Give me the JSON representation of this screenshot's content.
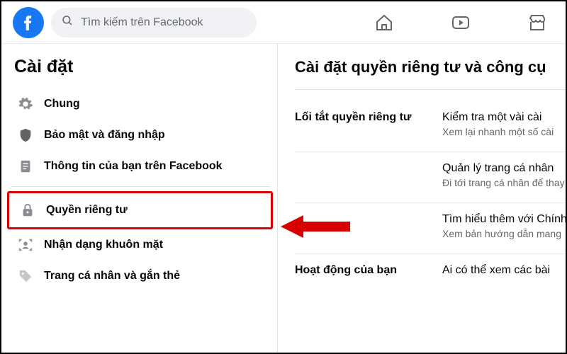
{
  "search": {
    "placeholder": "Tìm kiếm trên Facebook"
  },
  "sidebar": {
    "title": "Cài đặt",
    "items": [
      {
        "label": "Chung"
      },
      {
        "label": "Bảo mật và đăng nhập"
      },
      {
        "label": "Thông tin của bạn trên Facebook"
      },
      {
        "label": "Quyền riêng tư"
      },
      {
        "label": "Nhận dạng khuôn mặt"
      },
      {
        "label": "Trang cá nhân và gắn thẻ"
      }
    ]
  },
  "main": {
    "title": "Cài đặt quyền riêng tư và công cụ",
    "sections": [
      {
        "label": "Lối tắt quyền riêng tư",
        "items": [
          {
            "head": "Kiểm tra một vài cài",
            "sub": "Xem lại nhanh một số cài"
          },
          {
            "head": "Quản lý trang cá nhân",
            "sub": "Đi tới trang cá nhân để thay đổi quan hệ của bạn."
          },
          {
            "head": "Tìm hiểu thêm với Chính",
            "sub": "Xem bản hướng dẫn mang"
          }
        ]
      },
      {
        "label": "Hoạt động của bạn",
        "items": [
          {
            "head": "Ai có thể xem các bài"
          }
        ]
      }
    ]
  }
}
